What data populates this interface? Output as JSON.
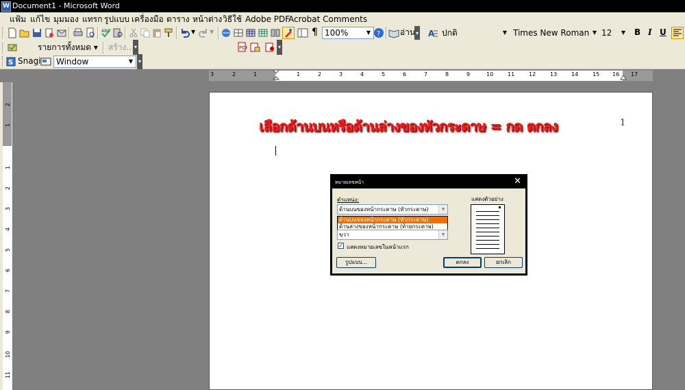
{
  "window": {
    "title": "Document1 - Microsoft Word"
  },
  "menu": [
    "แฟ้ม",
    "แก้ไข",
    "มุมมอง",
    "แทรก",
    "รูปแบบ",
    "เครื่องมือ",
    "ตาราง",
    "หน้าต่าง",
    "วิธีใช้",
    "Adobe PDF",
    "Acrobat Comments"
  ],
  "toolbar_standard": {
    "zoom": "100%",
    "read_label": "อ่าน",
    "style": "ปกติ",
    "font": "Times New Roman",
    "size": "12",
    "bold": "B",
    "italic": "I",
    "underline": "U",
    "pilcrow": "¶"
  },
  "toolbar_second": {
    "list_label": "รายการทั้งหมด",
    "create_label": "สร้าง..."
  },
  "toolbar_snagit": {
    "snagit_label": "Snagit",
    "capture_mode": "Window"
  },
  "ruler_h": [
    "3",
    "2",
    "1",
    "1",
    "2",
    "3",
    "4",
    "5",
    "6",
    "7",
    "8",
    "9",
    "10",
    "11",
    "12",
    "13",
    "14",
    "15",
    "16",
    "17"
  ],
  "ruler_v": [
    "2",
    "1",
    "1",
    "2",
    "3",
    "4",
    "5",
    "6",
    "7",
    "8",
    "9",
    "10",
    "11"
  ],
  "document": {
    "instruction": "เลือกด้านบนหรือด้านล่างของหัวกระดาษ = กด ตกลง",
    "page_number": "1"
  },
  "dialog": {
    "title": "หมายเลขหน้า",
    "position_label": "ตำแหน่ง:",
    "position_value": "ด้านบนของหน้ากระดาษ (หัวกระดาษ)",
    "position_options": [
      "ด้านบนของหน้ากระดาษ (หัวกระดาษ)",
      "ด้านล่างของหน้ากระดาษ (ท้ายกระดาษ)"
    ],
    "alignment_value": "ขวา",
    "show_first_page_label": "แสดงหมายเลขในหน้าแรก",
    "preview_label": "แสดงตัวอย่าง",
    "format_button": "รูปแบบ...",
    "ok_button": "ตกลง",
    "cancel_button": "ยกเลิก",
    "close_glyph": "✕"
  },
  "colors": {
    "instruction": "#ff1a1a",
    "selection": "#e8720c",
    "dialog_bg": "#ece9d8"
  }
}
